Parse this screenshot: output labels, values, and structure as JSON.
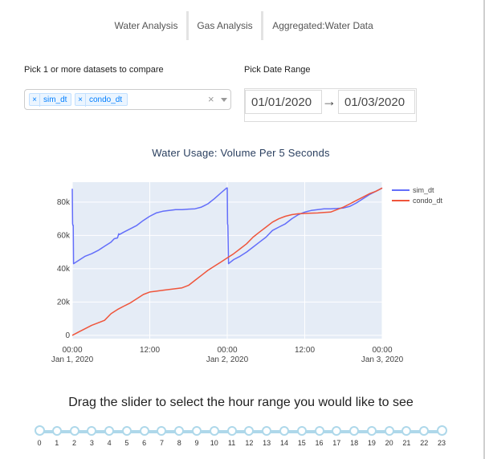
{
  "tabs": [
    "Water Analysis",
    "Gas Analysis",
    "Aggregated:Water Data"
  ],
  "datasets": {
    "label": "Pick 1 or more datasets to compare",
    "selected": [
      "sim_dt",
      "condo_dt"
    ],
    "clear_glyph": "×"
  },
  "date_range": {
    "label": "Pick Date Range",
    "start": "01/01/2020",
    "end": "01/03/2020",
    "arrow": "→"
  },
  "chart_data": {
    "type": "line",
    "title": "Water Usage: Volume Per 5 Seconds",
    "xlabel": "",
    "ylabel": "",
    "x_ticks": [
      "00:00",
      "12:00",
      "00:00",
      "12:00",
      "00:00"
    ],
    "x_tick_dates": [
      "Jan 1, 2020",
      "",
      "Jan 2, 2020",
      "",
      "Jan 3, 2020"
    ],
    "y_ticks": [
      "0",
      "20k",
      "40k",
      "60k",
      "80k"
    ],
    "ylim": [
      -2000,
      92000
    ],
    "xlim_hours": [
      0,
      48
    ],
    "legend_position": "top-right",
    "colors": {
      "sim_dt": "#636efa",
      "condo_dt": "#ef553b"
    },
    "series": [
      {
        "name": "sim_dt",
        "x": [
          0,
          0.05,
          0.1,
          0.15,
          0.2,
          1,
          2,
          3,
          4,
          5,
          6,
          6.5,
          7,
          7.2,
          7.3,
          8,
          9,
          10,
          11,
          12,
          13,
          14,
          15,
          16,
          17,
          18,
          19,
          20,
          21,
          22,
          23,
          23.9,
          24,
          24.05,
          24.1,
          24.2,
          25,
          26,
          27,
          28,
          29,
          30,
          31,
          32,
          33,
          34,
          35,
          36,
          37,
          38,
          39,
          40,
          41,
          42,
          43,
          44,
          45,
          46,
          47,
          48
        ],
        "values": [
          88000,
          67000,
          66000,
          66000,
          43000,
          45000,
          47500,
          49000,
          51000,
          53500,
          56000,
          58000,
          58500,
          61000,
          60500,
          62000,
          64000,
          66000,
          69000,
          71500,
          73500,
          74500,
          75000,
          75500,
          75500,
          75800,
          76000,
          77000,
          79000,
          82000,
          85500,
          88500,
          88500,
          67000,
          66000,
          43000,
          45500,
          47500,
          50000,
          53000,
          56000,
          59000,
          63000,
          65000,
          67000,
          70000,
          72500,
          74000,
          75000,
          75500,
          76000,
          76000,
          76200,
          76500,
          77500,
          79500,
          82000,
          84500,
          86500,
          88500
        ]
      },
      {
        "name": "condo_dt",
        "x": [
          0,
          1,
          2,
          3,
          4,
          5,
          6,
          7,
          8,
          9,
          10,
          11,
          12,
          13,
          14,
          15,
          16,
          17,
          18,
          19,
          20,
          21,
          22,
          23,
          24,
          25,
          26,
          27,
          28,
          29,
          30,
          31,
          32,
          33,
          34,
          35,
          36,
          37,
          38,
          39,
          40,
          41,
          42,
          43,
          44,
          45,
          46,
          47,
          48
        ],
        "values": [
          0,
          2000,
          4000,
          6000,
          7500,
          9000,
          13000,
          15500,
          17500,
          19500,
          22000,
          24500,
          26000,
          26500,
          27000,
          27500,
          28000,
          28500,
          30000,
          33000,
          36000,
          39000,
          41500,
          44000,
          46500,
          49000,
          52000,
          55000,
          59000,
          62000,
          65000,
          68000,
          70000,
          71500,
          72500,
          73000,
          73200,
          73400,
          73500,
          73800,
          74000,
          75500,
          77000,
          79000,
          81000,
          83000,
          85000,
          86500,
          88500
        ]
      }
    ]
  },
  "slider": {
    "title": "Drag the slider to select the hour range you would like to see",
    "marks": [
      "0",
      "1",
      "2",
      "3",
      "4",
      "5",
      "6",
      "7",
      "8",
      "9",
      "10",
      "11",
      "12",
      "13",
      "14",
      "15",
      "16",
      "17",
      "18",
      "19",
      "20",
      "21",
      "22",
      "23"
    ]
  }
}
